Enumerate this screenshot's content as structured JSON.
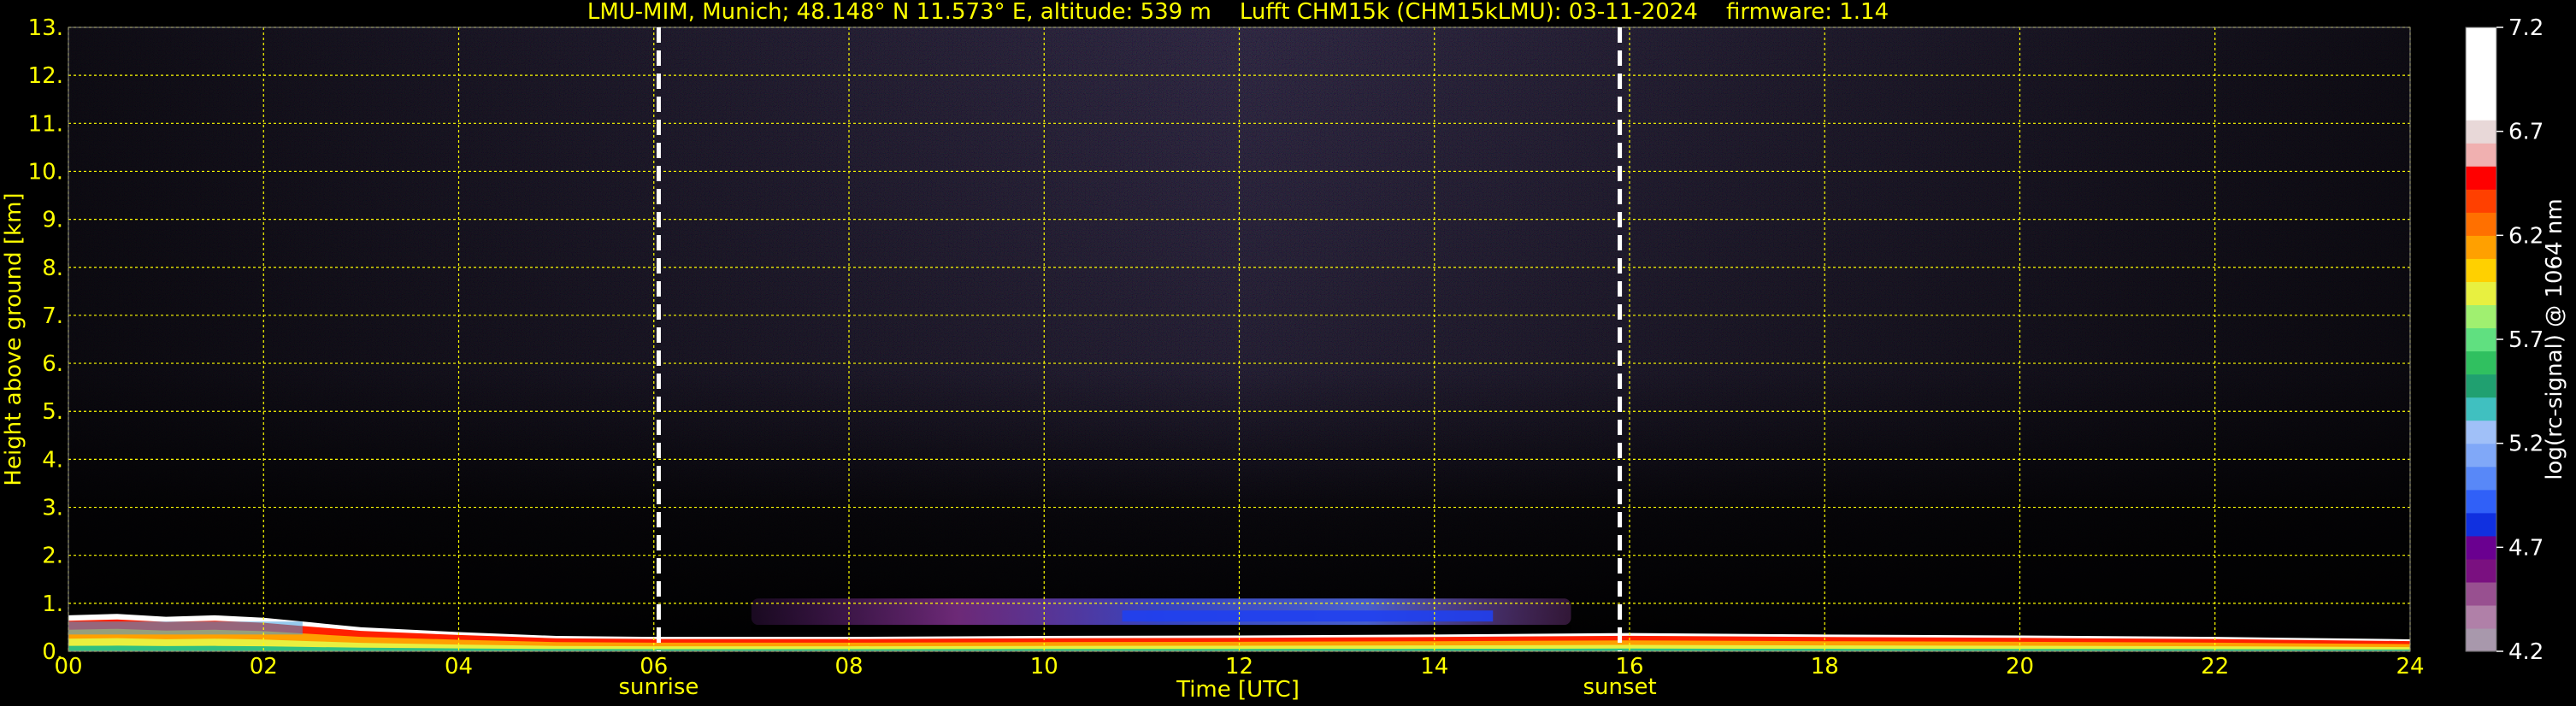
{
  "chart_data": {
    "type": "heatmap",
    "title": "LMU-MIM, Munich; 48.148° N 11.573° E, altitude: 539 m    Lufft CHM15k (CHM15kLMU): 03-11-2024    firmware: 1.14",
    "xlabel": "Time [UTC]",
    "ylabel": "Height above ground [km]",
    "xlim": [
      0,
      24
    ],
    "ylim": [
      0,
      13
    ],
    "x_ticks": [
      "00",
      "02",
      "04",
      "06",
      "08",
      "10",
      "12",
      "14",
      "16",
      "18",
      "20",
      "22",
      "24"
    ],
    "y_ticks": [
      "0.",
      "1.",
      "2.",
      "3.",
      "4.",
      "5.",
      "6.",
      "7.",
      "8.",
      "9.",
      "10.",
      "11.",
      "12.",
      "13."
    ],
    "grid": true,
    "colors": {
      "background": "#000000",
      "text": "#ffff00",
      "grid": "#ffff00",
      "noise_bg": "#5a4a9a",
      "markers": "#ffffff"
    },
    "markers": [
      {
        "label": "sunrise",
        "time": 6.05
      },
      {
        "label": "sunset",
        "time": 15.9
      }
    ],
    "colorbar": {
      "label": "log(rc-signal) @ 1064 nm",
      "range": [
        4.2,
        7.2
      ],
      "ticks": [
        "7.2",
        "6.7",
        "6.2",
        "5.7",
        "5.2",
        "4.7",
        "4.2"
      ],
      "palette": [
        "#a898ac",
        "#b080a8",
        "#985090",
        "#7a1080",
        "#6a0090",
        "#1030e0",
        "#3060f8",
        "#5888f8",
        "#80a8f8",
        "#a0c0f8",
        "#40c0c0",
        "#20a070",
        "#30c060",
        "#60e080",
        "#a0f070",
        "#e8f040",
        "#ffd000",
        "#ffa000",
        "#ff7000",
        "#ff4000",
        "#ff0000",
        "#f0b0b0",
        "#e8d8d8",
        "#ffffff",
        "#ffffff",
        "#ffffff",
        "#ffffff"
      ]
    },
    "layers": [
      {
        "name": "surface layer",
        "x": [
          0,
          0.5,
          1,
          1.5,
          2,
          2.5,
          3,
          4,
          5,
          6,
          8,
          10,
          12,
          14,
          16,
          18,
          20,
          22,
          24
        ],
        "top_km": [
          0.75,
          0.78,
          0.72,
          0.75,
          0.7,
          0.6,
          0.5,
          0.4,
          0.32,
          0.3,
          0.3,
          0.32,
          0.33,
          0.35,
          0.38,
          0.35,
          0.33,
          0.3,
          0.25
        ]
      },
      {
        "name": "aerosol band",
        "x_range": [
          7.0,
          15.4
        ],
        "base_km": 0.55,
        "top_km": 1.1
      }
    ]
  }
}
